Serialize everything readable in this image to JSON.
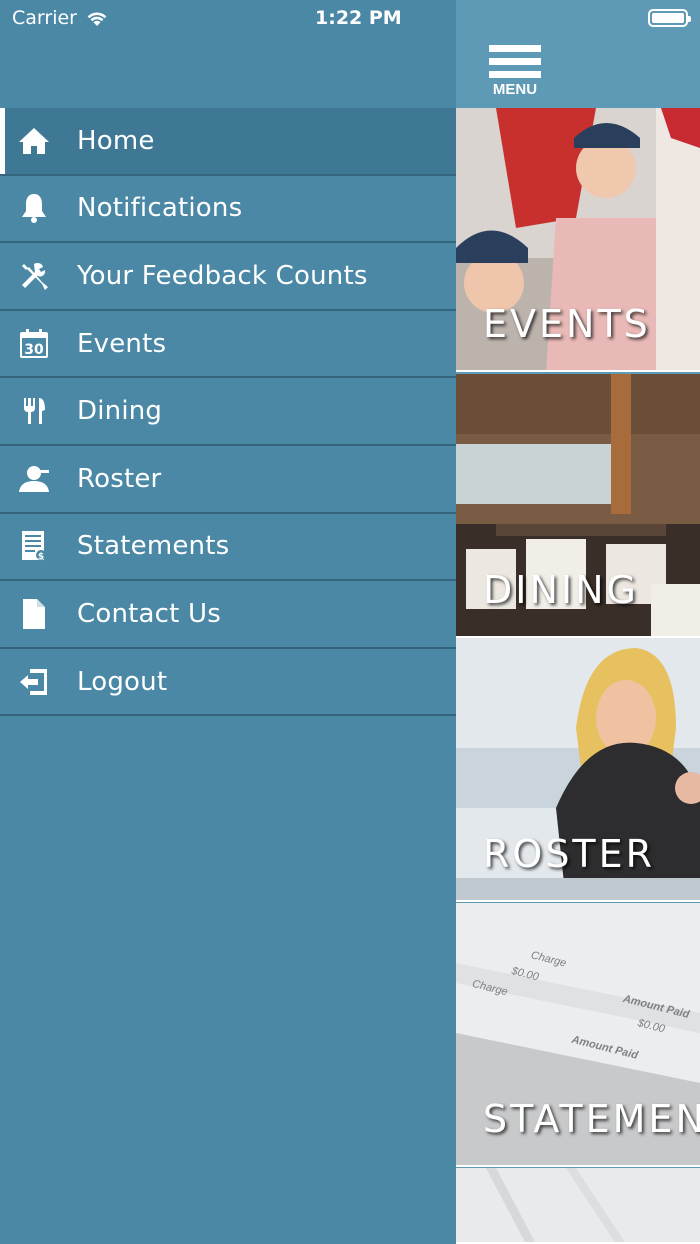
{
  "status_bar": {
    "carrier": "Carrier",
    "time": "1:22 PM"
  },
  "drawer": {
    "items": [
      {
        "label": "Home",
        "icon": "home-icon",
        "active": true
      },
      {
        "label": "Notifications",
        "icon": "bell-icon",
        "active": false
      },
      {
        "label": "Your Feedback Counts",
        "icon": "tools-icon",
        "active": false
      },
      {
        "label": "Events",
        "icon": "calendar-icon",
        "active": false
      },
      {
        "label": "Dining",
        "icon": "fork-knife-icon",
        "active": false
      },
      {
        "label": "Roster",
        "icon": "person-icon",
        "active": false
      },
      {
        "label": "Statements",
        "icon": "statement-icon",
        "active": false
      },
      {
        "label": "Contact Us",
        "icon": "document-icon",
        "active": false
      },
      {
        "label": "Logout",
        "icon": "logout-icon",
        "active": false
      }
    ],
    "calendar_day": "30"
  },
  "header": {
    "menu_label": "MENU"
  },
  "tiles": [
    {
      "label": "EVENTS"
    },
    {
      "label": "DINING"
    },
    {
      "label": "ROSTER"
    },
    {
      "label": "STATEMEN"
    }
  ],
  "statement_image_text": {
    "charge_1": "Charge",
    "amount_1": "$0.00",
    "charge_2": "Charge",
    "amount_paid_1": "Amount Paid",
    "amount_2": "$0.00",
    "amount_paid_2": "Amount Paid"
  },
  "colors": {
    "drawer_bg": "#4a88a5",
    "active_item_bg": "#3f7894",
    "divider": "#35657c",
    "topbar_bg": "#5e9ab5"
  }
}
